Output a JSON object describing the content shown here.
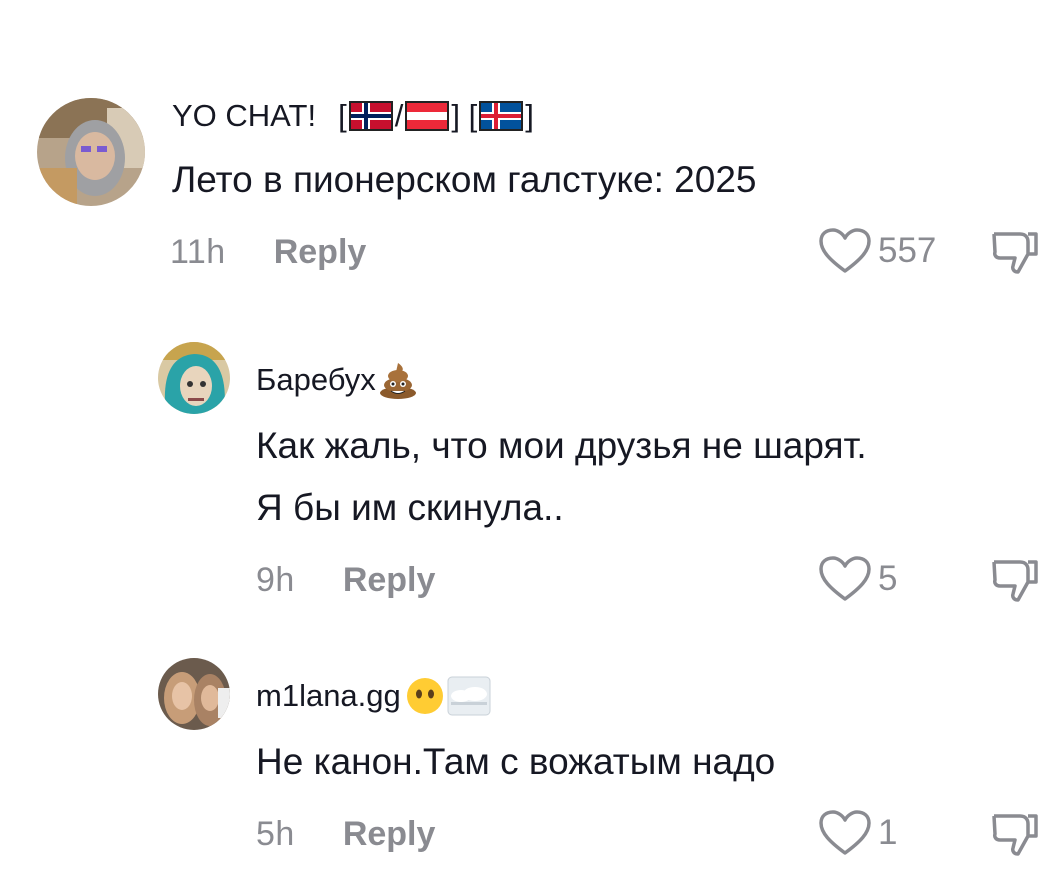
{
  "comments": [
    {
      "username": "YO CHAT!",
      "username_suffix_1": "[",
      "username_suffix_2": "/",
      "username_suffix_3": "] [",
      "username_suffix_4": "]",
      "text": "Лето в пионерском галстуке: 2025",
      "time": "11h",
      "reply_label": "Reply",
      "likes": "557"
    },
    {
      "username": "Баребух",
      "text_line1": "Как жаль, что мои друзья не шарят.",
      "text_line2": "Я бы им скинула..",
      "time": "9h",
      "reply_label": "Reply",
      "likes": "5"
    },
    {
      "username": "m1lana.gg",
      "text": "Не канон.Там с вожатым надо",
      "time": "5h",
      "reply_label": "Reply",
      "likes": "1"
    }
  ],
  "icons": {
    "like": "heart-outline-icon",
    "dislike": "thumbs-down-icon",
    "emoji_poop": "pile-of-poo-emoji",
    "emoji_nomouth": "face-without-mouth-emoji",
    "emoji_fog": "fog-emoji",
    "flags": [
      "norway-flag",
      "austria-flag",
      "iceland-flag"
    ]
  },
  "colors": {
    "text": "#161823",
    "muted": "#8a8b91"
  }
}
